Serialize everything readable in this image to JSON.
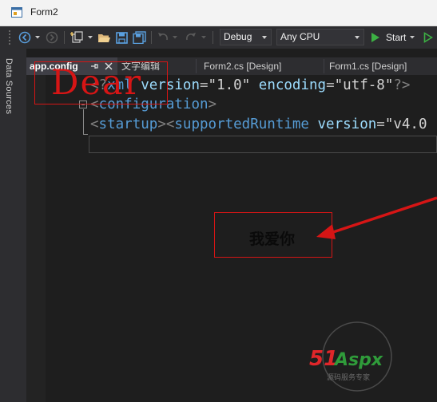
{
  "window": {
    "title": "Form2"
  },
  "toolbar": {
    "configuration": "Debug",
    "platform": "Any CPU",
    "start_label": "Start"
  },
  "sidebar": {
    "label": "Data Sources"
  },
  "tabs": [
    {
      "label": "app.config",
      "active": true
    },
    {
      "label": "文字编辑",
      "active": false
    },
    {
      "label": "Form2.cs [Design]",
      "active": false
    },
    {
      "label": "Form1.cs [Design]",
      "active": false
    }
  ],
  "editor": {
    "lines": [
      {
        "bracket_open": "<?",
        "tag": "xml",
        "attr1": "version",
        "val1": "\"1.0\"",
        "attr2": "encoding",
        "val2": "\"utf-8\"",
        "bracket_close": "?>"
      },
      {
        "bracket_open": "<",
        "tag": "configuration",
        "bracket_close": ">"
      },
      {
        "bracket_open": "<",
        "tag": "startup",
        "bracket_mid": "><",
        "tag2": "supportedRuntime",
        "attr1": "version",
        "val1": "\"v4.0"
      }
    ]
  },
  "overlay": {
    "dear_text": "Dear",
    "love_text": "我爱你",
    "annotation_color": "#d61515"
  },
  "watermark": {
    "brand": "51Aspx",
    "brand_main": "51",
    "brand_tail": "Aspx",
    "subtitle": "源码服务专家"
  }
}
